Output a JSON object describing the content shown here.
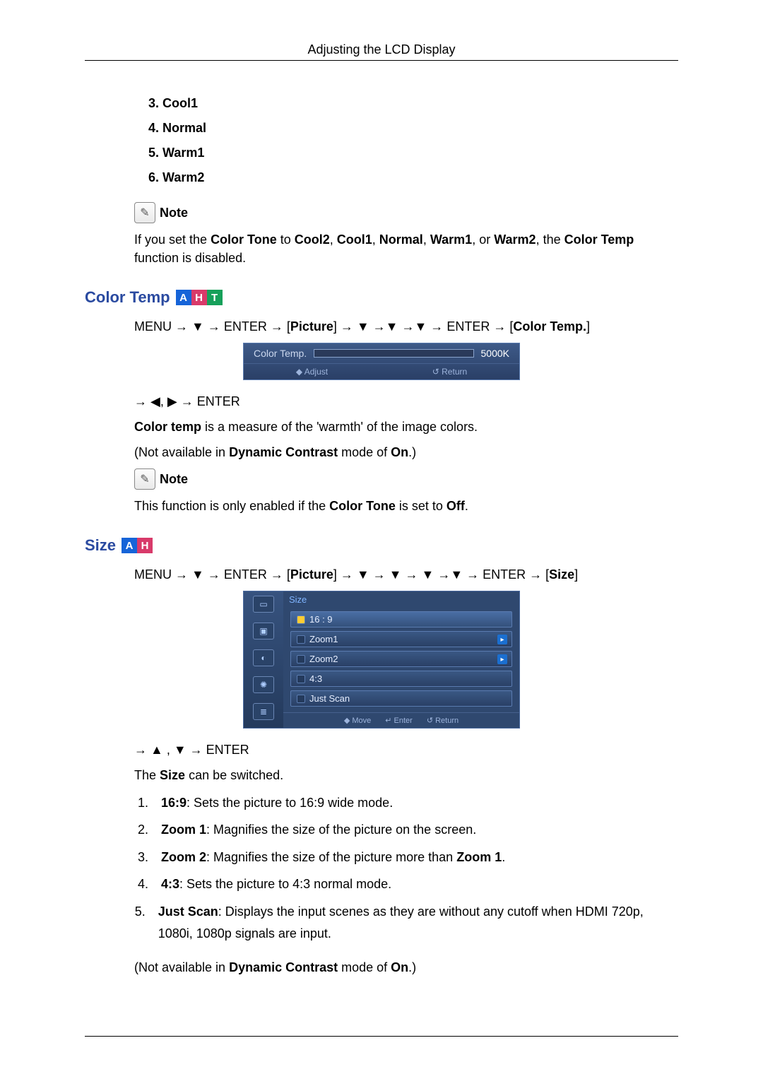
{
  "header": "Adjusting the LCD Display",
  "list1": [
    "Cool1",
    "Normal",
    "Warm1",
    "Warm2"
  ],
  "list1_start": 3,
  "note_label": "Note",
  "note1_html": "If you set the <b>Color Tone</b> to <b>Cool2</b>, <b>Cool1</b>, <b>Normal</b>, <b>Warm1</b>, or <b>Warm2</b>, the <b>Color Temp</b> function is disabled.",
  "sect_color_temp": {
    "title": "Color Temp",
    "tags": [
      "A",
      "H",
      "T"
    ],
    "path_html": "MENU → ▼ → ENTER → [<b>Picture</b>] → ▼ →▼ →▼ → ENTER → [<b>Color Temp.</b>]",
    "osd_label": "Color Temp.",
    "osd_value": "5000K",
    "osd_adjust": "◆ Adjust",
    "osd_return": "↺ Return",
    "path2_html": "→ ◀, ▶ → ENTER",
    "desc_html": "<b>Color temp</b> is a measure of the 'warmth' of the image colors.",
    "na_html": "(Not available in <b>Dynamic Contrast</b> mode of <b>On</b>.)",
    "note2_html": "This function is only enabled if the <b>Color Tone</b> is set to <b>Off</b>."
  },
  "sect_size": {
    "title": "Size",
    "tags": [
      "A",
      "H"
    ],
    "path_html": "MENU → ▼ → ENTER → [<b>Picture</b>] → ▼ → ▼ → ▼ →▼ → ENTER → [<b>Size</b>]",
    "osd_title": "Size",
    "osd_options": [
      {
        "label": "16 : 9",
        "sel": true,
        "chev": false
      },
      {
        "label": "Zoom1",
        "sel": false,
        "chev": true
      },
      {
        "label": "Zoom2",
        "sel": false,
        "chev": true
      },
      {
        "label": "4:3",
        "sel": false,
        "chev": false
      },
      {
        "label": "Just Scan",
        "sel": false,
        "chev": false
      }
    ],
    "osd_move": "◆ Move",
    "osd_enter": "↵ Enter",
    "osd_return": "↺ Return",
    "path2_html": "→ ▲ , ▼ → ENTER",
    "desc_html": "The <b>Size</b> can be switched.",
    "items": [
      {
        "n": "1.",
        "html": "<b>16:9</b>: Sets the picture to 16:9 wide mode."
      },
      {
        "n": "2.",
        "html": "<b>Zoom 1</b>: Magnifies the size of the picture on the screen."
      },
      {
        "n": "3.",
        "html": "<b>Zoom 2</b>: Magnifies the size of the picture more than <b>Zoom 1</b>."
      },
      {
        "n": "4.",
        "html": "<b>4:3</b>: Sets the picture to 4:3 normal mode."
      },
      {
        "n": "5.",
        "html": "<b>Just Scan</b>: Displays the input scenes as they are without any cutoff when HDMI 720p, 1080i, 1080p signals are input."
      }
    ],
    "na_html": "(Not available in <b>Dynamic Contrast</b> mode of <b>On</b>.)"
  }
}
